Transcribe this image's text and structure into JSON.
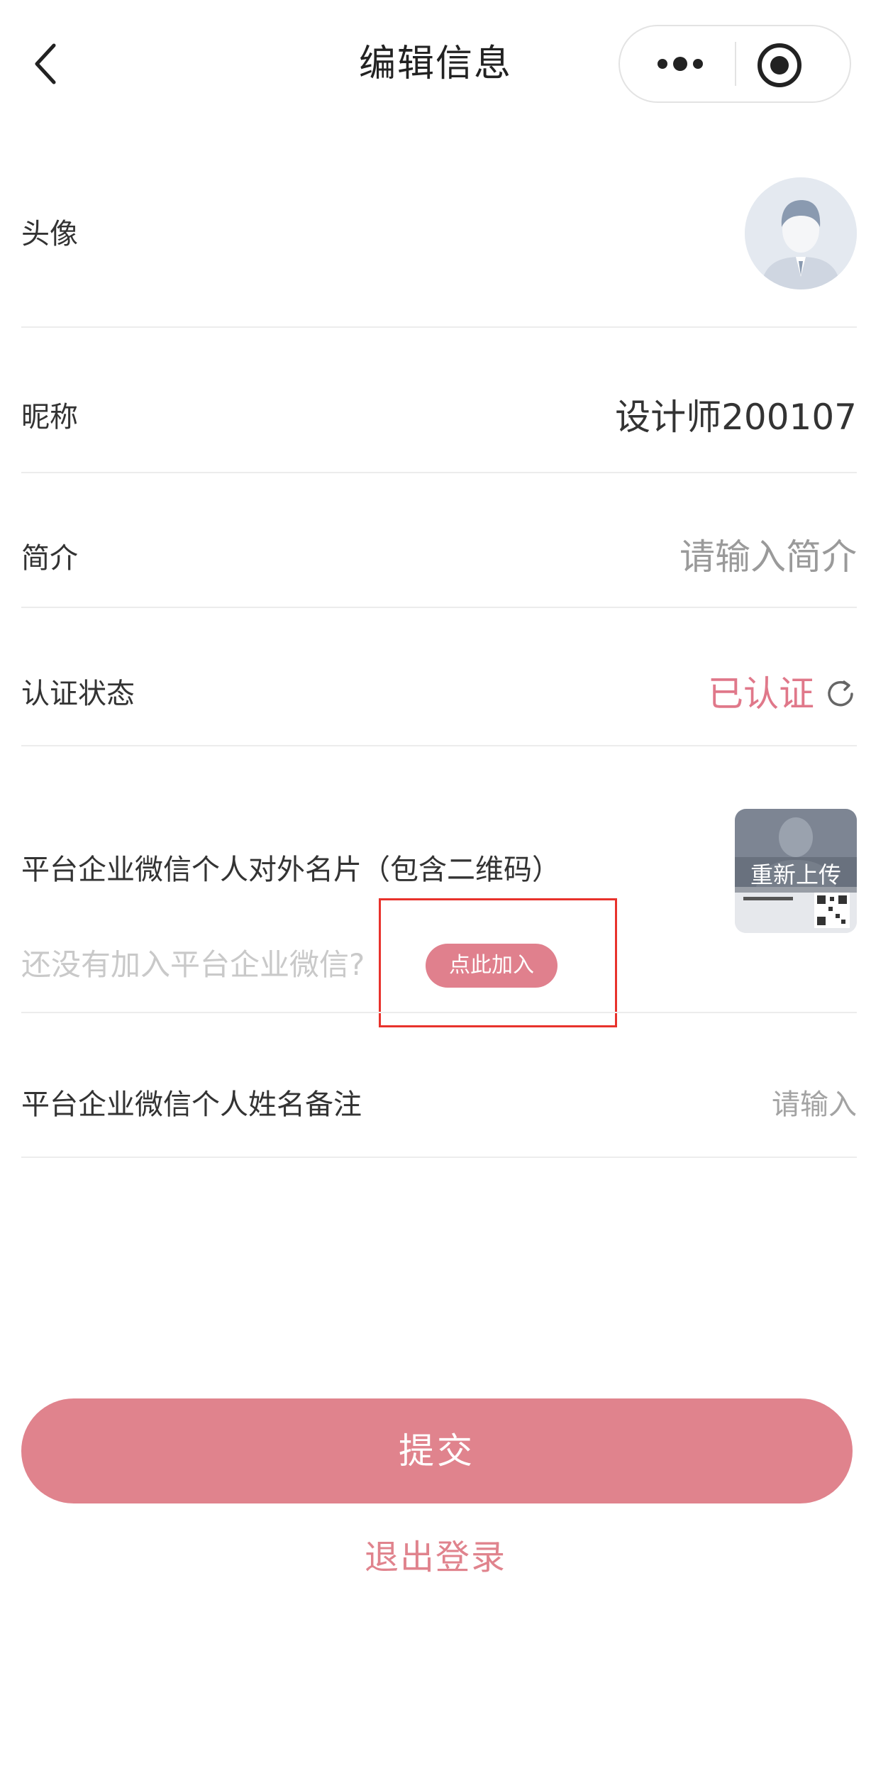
{
  "header": {
    "title": "编辑信息",
    "back_icon": "chevron-left-icon",
    "more_icon": "more-dots-icon",
    "close_icon": "target-circle-icon"
  },
  "rows": {
    "avatar": {
      "label": "头像"
    },
    "nickname": {
      "label": "昵称",
      "value": "设计师200107"
    },
    "bio": {
      "label": "简介",
      "placeholder": "请输入简介"
    },
    "certification": {
      "label": "认证状态",
      "value": "已认证",
      "icon": "refresh-icon"
    },
    "wecom_card": {
      "label": "平台企业微信个人对外名片（包含二维码）",
      "thumb_label": "重新上传",
      "join_hint": "还没有加入平台企业微信?",
      "join_button": "点此加入"
    },
    "name_remark": {
      "label": "平台企业微信个人姓名备注",
      "placeholder": "请输入"
    }
  },
  "actions": {
    "submit": "提交",
    "logout": "退出登录"
  },
  "colors": {
    "accent": "#e0838d",
    "highlight": "#e8322c"
  }
}
